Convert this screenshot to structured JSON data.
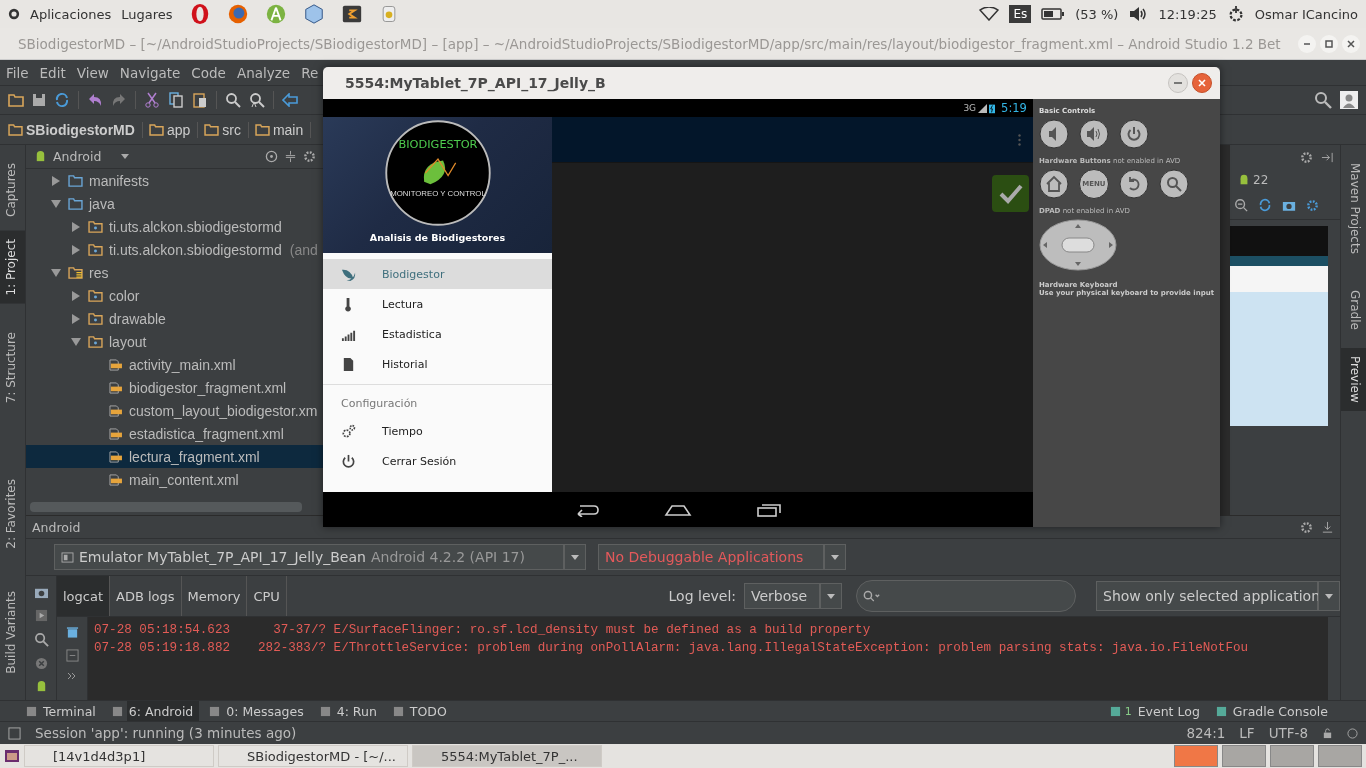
{
  "desktop_bar": {
    "menus": [
      "Aplicaciones",
      "Lugares"
    ],
    "keyboard": "Es",
    "battery": "(53 %)",
    "clock": "12:19:25",
    "user": "Osmar ICancino"
  },
  "ide": {
    "title": "SBiodigestorMD – [~/AndroidStudioProjects/SBiodigestorMD] – [app] – ~/AndroidStudioProjects/SBiodigestorMD/app/src/main/res/layout/biodigestor_fragment.xml – Android Studio 1.2 Bet",
    "menu": [
      "File",
      "Edit",
      "View",
      "Navigate",
      "Code",
      "Analyze",
      "Re"
    ],
    "breadcrumb": [
      "SBiodigestorMD",
      "app",
      "src",
      "main"
    ],
    "left_tools": [
      {
        "label": "Captures",
        "selected": false
      },
      {
        "label": "1: Project",
        "selected": true
      },
      {
        "label": "7: Structure",
        "selected": false
      },
      {
        "label": "2: Favorites",
        "selected": false
      },
      {
        "label": "Build Variants",
        "selected": false
      }
    ],
    "right_tools": [
      {
        "label": "Maven Projects",
        "selected": false
      },
      {
        "label": "Gradle",
        "selected": false
      },
      {
        "label": "Preview",
        "selected": true
      }
    ],
    "project_panel": {
      "view": "Android",
      "tree": [
        {
          "label": "manifests",
          "kind": "folder",
          "expanded": false,
          "selected": false
        },
        {
          "label": "java",
          "kind": "folder",
          "expanded": true,
          "selected": false,
          "children": [
            {
              "label": "ti.uts.alckon.sbiodigestormd",
              "kind": "package",
              "expanded": false,
              "selected": false
            },
            {
              "label": "ti.uts.alckon.sbiodigestormd",
              "suffix": "(and",
              "kind": "package",
              "expanded": false,
              "selected": false
            }
          ]
        },
        {
          "label": "res",
          "kind": "res",
          "expanded": true,
          "selected": false,
          "children": [
            {
              "label": "color",
              "kind": "package",
              "expanded": false,
              "selected": false
            },
            {
              "label": "drawable",
              "kind": "package",
              "expanded": false,
              "selected": false
            },
            {
              "label": "layout",
              "kind": "package",
              "expanded": true,
              "selected": false,
              "children": [
                {
                  "label": "activity_main.xml",
                  "kind": "file",
                  "selected": false
                },
                {
                  "label": "biodigestor_fragment.xml",
                  "kind": "file",
                  "selected": false
                },
                {
                  "label": "custom_layout_biodigestor.xm",
                  "kind": "file",
                  "selected": false
                },
                {
                  "label": "estadistica_fragment.xml",
                  "kind": "file",
                  "selected": false
                },
                {
                  "label": "lectura_fragment.xml",
                  "kind": "file",
                  "selected": true
                },
                {
                  "label": "main_content.xml",
                  "kind": "file",
                  "selected": false
                }
              ]
            }
          ]
        }
      ]
    },
    "preview_api": "22",
    "bottom_panel": {
      "title": "Android",
      "device": "Emulator MyTablet_7P_API_17_Jelly_Bean",
      "device_detail": "Android 4.2.2 (API 17)",
      "process": "No Debuggable Applications",
      "tabs": [
        {
          "label": "logcat",
          "selected": true
        },
        {
          "label": "ADB logs",
          "selected": false
        },
        {
          "label": "Memory",
          "selected": false
        },
        {
          "label": "CPU",
          "selected": false
        }
      ],
      "log_level_label": "Log level:",
      "log_level": "Verbose",
      "filter": "Show only selected application",
      "log": [
        {
          "time": "07-28 05:18:54.623",
          "pid": "37-37/?",
          "message": "E/SurfaceFlinger: ro.sf.lcd_density must be defined as a build property",
          "kind": "error"
        },
        {
          "time": "07-28 05:19:18.882",
          "pid": "282-383/?",
          "message": "E/ThrottleService: problem during onPollAlarm: java.lang.IllegalStateException: problem parsing stats: java.io.FileNotFou",
          "kind": "error"
        }
      ]
    },
    "tool_tabs": [
      {
        "label": "Terminal",
        "selected": false
      },
      {
        "label": "6: Android",
        "selected": true
      },
      {
        "label": "0: Messages",
        "selected": false
      },
      {
        "label": "4: Run",
        "selected": false
      },
      {
        "label": "TODO",
        "selected": false
      }
    ],
    "right_tabs": [
      {
        "label": "Event Log",
        "badge": "1"
      },
      {
        "label": "Gradle Console"
      }
    ],
    "status": {
      "message": "Session 'app': running (3 minutes ago)",
      "position": "824:1",
      "line_sep": "LF",
      "encoding": "UTF-8"
    }
  },
  "emulator": {
    "title": "5554:MyTablet_7P_API_17_Jelly_B",
    "network": "3G",
    "clock": "5:19",
    "drawer": {
      "logo_top": "BIODIGESTOR",
      "logo_bottom": "MONITOREO Y CONTROL",
      "header": "Analisis de Biodigestores",
      "items": [
        {
          "label": "Biodigestor",
          "kind": "leaf",
          "selected": true
        },
        {
          "label": "Lectura",
          "kind": "thermometer",
          "selected": false
        },
        {
          "label": "Estadistica",
          "kind": "bars",
          "selected": false
        },
        {
          "label": "Historial",
          "kind": "document",
          "selected": false
        }
      ],
      "section": "Configuración",
      "settings": [
        {
          "label": "Tiempo",
          "kind": "gears",
          "selected": false
        },
        {
          "label": "Cerrar Sesión",
          "kind": "power",
          "selected": false
        }
      ]
    },
    "controls": {
      "basic": "Basic Controls",
      "hardware": "**Hardware Buttons** not enabled in AVD",
      "menu_key": "MENU",
      "dpad": "**DPAD** not enabled in AVD",
      "keyboard_title": "Hardware Keyboard",
      "keyboard_hint": "Use your physical keyboard to provide input"
    }
  },
  "taskbar": [
    {
      "label": "[14v1d4d3p1]",
      "selected": false
    },
    {
      "label": "SBiodigestorMD - [~/...",
      "selected": false
    },
    {
      "label": "5554:MyTablet_7P_...",
      "selected": true
    }
  ]
}
